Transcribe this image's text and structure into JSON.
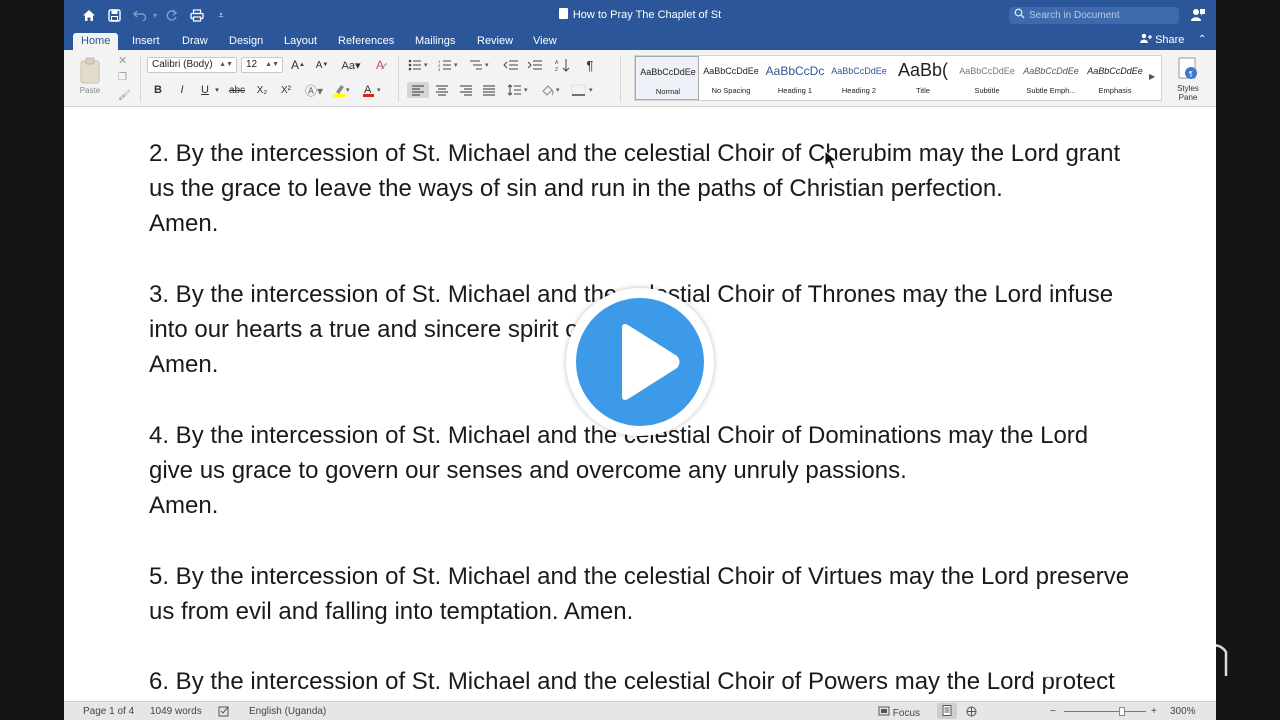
{
  "window": {
    "title": "How to Pray The Chaplet of St",
    "search_placeholder": "Search in Document"
  },
  "quick_access": {
    "icons": [
      "home-icon",
      "save-icon",
      "undo-icon",
      "redo-icon",
      "print-icon",
      "customize-icon"
    ]
  },
  "tabs": [
    {
      "label": "Home",
      "active": true
    },
    {
      "label": "Insert"
    },
    {
      "label": "Draw"
    },
    {
      "label": "Design"
    },
    {
      "label": "Layout"
    },
    {
      "label": "References"
    },
    {
      "label": "Mailings"
    },
    {
      "label": "Review"
    },
    {
      "label": "View"
    }
  ],
  "share_label": "Share",
  "ribbon": {
    "paste_label": "Paste",
    "font_name": "Calibri (Body)",
    "font_size": "12",
    "format_buttons": [
      "B",
      "I",
      "U",
      "abc",
      "X₂",
      "X²"
    ],
    "font_color": "#e02020",
    "highlight_color": "#ffff00",
    "styles": [
      {
        "sample": "AaBbCcDdEe",
        "name": "Normal"
      },
      {
        "sample": "AaBbCcDdEe",
        "name": "No Spacing"
      },
      {
        "sample": "AaBbCcDc",
        "name": "Heading 1"
      },
      {
        "sample": "AaBbCcDdEe",
        "name": "Heading 2"
      },
      {
        "sample": "AaBb(",
        "name": "Title"
      },
      {
        "sample": "AaBbCcDdEe",
        "name": "Subtitle"
      },
      {
        "sample": "AaBbCcDdEe",
        "name": "Subtle Emph..."
      },
      {
        "sample": "AaBbCcDdEe",
        "name": "Emphasis"
      }
    ],
    "styles_pane_label_1": "Styles",
    "styles_pane_label_2": "Pane"
  },
  "document": {
    "lines": [
      "2. By the intercession of St. Michael and the celestial Choir of Cherubim may the Lord grant",
      "us the grace to leave the ways of sin and run in the paths of Christian perfection.",
      "Amen.",
      "",
      "3. By the intercession of St. Michael and the celestial Choir of Thrones may the Lord infuse",
      "into our hearts a true and sincere spirit of humility.",
      "Amen.",
      "",
      "4. By the intercession of St. Michael and the celestial Choir of Dominations may the Lord",
      "give us grace to govern our senses and overcome any unruly passions.",
      "Amen.",
      "",
      "5. By the intercession of St. Michael and the celestial Choir of Virtues may the Lord preserve",
      "us from evil and falling into temptation. Amen.",
      "",
      "6. By the intercession of St. Michael and the celestial Choir of Powers may the Lord protect"
    ]
  },
  "status": {
    "page": "Page 1 of 4",
    "words": "1049 words",
    "language": "English (Uganda)",
    "focus": "Focus",
    "zoom": "300%"
  },
  "overlay": {
    "play_color": "#3d9ae8",
    "watermark_icon": "zoom-logo-icon"
  }
}
